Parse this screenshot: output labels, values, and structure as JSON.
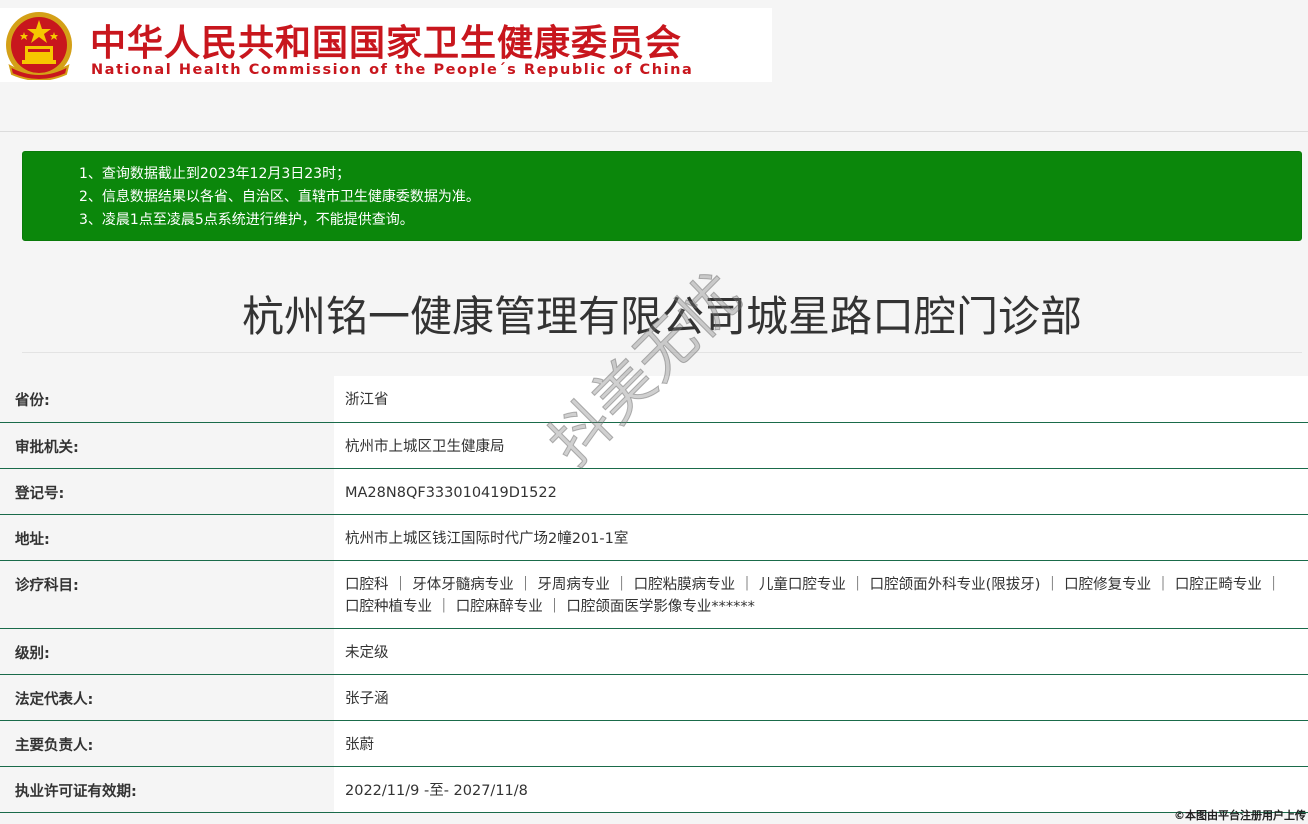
{
  "header": {
    "title_cn": "中华人民共和国国家卫生健康委员会",
    "title_en": "National Health Commission of the People´s Republic of China"
  },
  "notice": [
    "1、查询数据截止到2023年12月3日23时；",
    "2、信息数据结果以各省、自治区、直辖市卫生健康委数据为准。",
    "3、凌晨1点至凌晨5点系统进行维护，不能提供查询。"
  ],
  "institution": {
    "name": "杭州铭一健康管理有限公司城星路口腔门诊部"
  },
  "rows": [
    {
      "label": "省份:",
      "value": "浙江省"
    },
    {
      "label": "审批机关:",
      "value": "杭州市上城区卫生健康局"
    },
    {
      "label": "登记号:",
      "value": "MA28N8QF333010419D1522"
    },
    {
      "label": "地址:",
      "value": "杭州市上城区钱江国际时代广场2幢201-1室"
    },
    {
      "label": "诊疗科目:",
      "value": "口腔科 ｜ 牙体牙髓病专业 ｜ 牙周病专业 ｜ 口腔粘膜病专业 ｜ 儿童口腔专业 ｜ 口腔颌面外科专业(限拔牙) ｜ 口腔修复专业 ｜ 口腔正畸专业 ｜ 口腔种植专业 ｜ 口腔麻醉专业 ｜ 口腔颌面医学影像专业******"
    },
    {
      "label": "级别:",
      "value": "未定级"
    },
    {
      "label": "法定代表人:",
      "value": "张子涵"
    },
    {
      "label": "主要负责人:",
      "value": "张蔚"
    },
    {
      "label": "执业许可证有效期:",
      "value": "2022/11/9 -至- 2027/11/8"
    }
  ],
  "watermark": "抖美无忧",
  "footer_note": "©本图由平台注册用户上传",
  "colors": {
    "notice_bg": "#0b870b",
    "logo_red": "#c8161d",
    "row_border": "#1a6b4a"
  }
}
